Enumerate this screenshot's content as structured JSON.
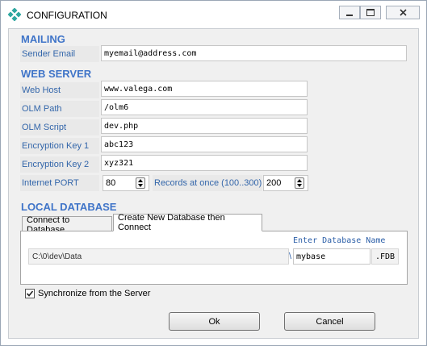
{
  "window": {
    "title": "CONFIGURATION"
  },
  "mailing": {
    "heading": "MAILING",
    "sender_email_label": "Sender Email",
    "sender_email_value": "myemail@address.com"
  },
  "web_server": {
    "heading": "WEB SERVER",
    "web_host_label": "Web Host",
    "web_host_value": "www.valega.com",
    "olm_path_label": "OLM Path",
    "olm_path_value": "/olm6",
    "olm_script_label": "OLM Script",
    "olm_script_value": "dev.php",
    "enc_key1_label": "Encryption Key 1",
    "enc_key1_value": "abc123",
    "enc_key2_label": "Encryption Key 2",
    "enc_key2_value": "xyz321",
    "port_label": "Internet PORT",
    "port_value": "80",
    "records_label": "Records at once (100..300)",
    "records_value": "200"
  },
  "local_db": {
    "heading": "LOCAL DATABASE",
    "tabs": [
      {
        "label": "Connect to Database",
        "active": false
      },
      {
        "label": "Create New Database then Connect",
        "active": true
      }
    ],
    "enter_db_name_label": "Enter Database Name",
    "path_value": "C:\\0\\dev\\Data",
    "separator": "\\",
    "db_name_value": "mybase",
    "extension": ".FDB"
  },
  "sync": {
    "label": "Synchronize from the Server",
    "checked": true
  },
  "buttons": {
    "ok": "Ok",
    "cancel": "Cancel"
  },
  "colors": {
    "section_heading": "#3f74c8",
    "label_text": "#3366aa"
  }
}
